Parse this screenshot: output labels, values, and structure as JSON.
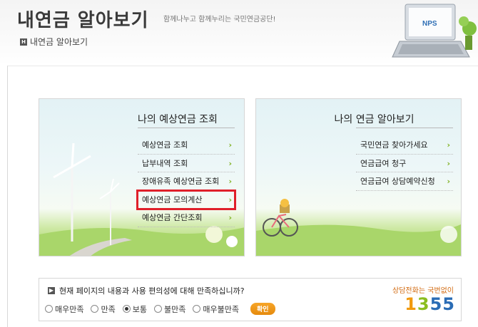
{
  "header": {
    "title": "내연금 알아보기",
    "slogan": "함께나누고 함께누리는 국민연금공단!",
    "breadcrumb": "내연금 알아보기",
    "laptop_logo": "NPS"
  },
  "left_panel": {
    "title": "나의 예상연금 조회",
    "items": [
      {
        "label": "예상연금 조회"
      },
      {
        "label": "납부내역 조회"
      },
      {
        "label": "장애유족 예상연금 조회"
      },
      {
        "label": "예상연금 모의계산"
      },
      {
        "label": "예상연금 간단조회"
      }
    ],
    "highlighted_index": 3
  },
  "right_panel": {
    "title": "나의 연금 알아보기",
    "items": [
      {
        "label": "국민연금 찾아가세요"
      },
      {
        "label": "연금급여 청구"
      },
      {
        "label": "연금급여 상담예약신청"
      }
    ]
  },
  "survey": {
    "question": "현재 페이지의 내용과 사용 편의성에 대해 만족하십니까?",
    "options": [
      "매우만족",
      "만족",
      "보통",
      "불만족",
      "매우불만족"
    ],
    "selected": "보통",
    "confirm_label": "확인",
    "hotline_label": "상담전화는 국번없이",
    "hotline_number": "1355",
    "hotline_digits": [
      "1",
      "3",
      "5",
      "5"
    ]
  },
  "colors": {
    "highlight_border": "#e0202a",
    "arrow": "#7fb020",
    "confirm_button": "#f39a1a"
  }
}
